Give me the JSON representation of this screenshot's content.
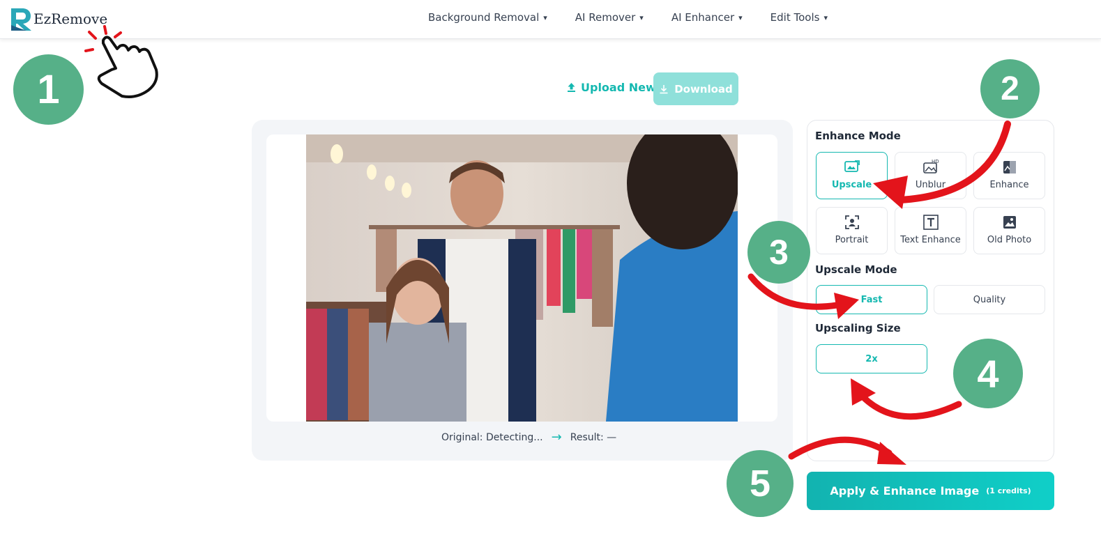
{
  "header": {
    "logo_text": "EzRemove",
    "nav": [
      {
        "label": "Background Removal",
        "caret": "▾"
      },
      {
        "label": "AI Remover",
        "caret": "▾"
      },
      {
        "label": "AI Enhancer",
        "caret": "▾"
      },
      {
        "label": "Edit Tools",
        "caret": "▾"
      }
    ]
  },
  "toolbar": {
    "upload_label": "Upload New",
    "upload_icon": "upload-icon",
    "download_label": "Download",
    "download_icon": "download-icon"
  },
  "preview": {
    "original_text": "Original: Detecting...",
    "arrow": "→",
    "result_text": "Result: —"
  },
  "panel": {
    "enhance_mode_label": "Enhance Mode",
    "modes": [
      {
        "label": "Upscale",
        "icon": "upscale-icon",
        "active": true
      },
      {
        "label": "Unblur",
        "icon": "hd-icon",
        "active": false
      },
      {
        "label": "Enhance",
        "icon": "enhance-icon",
        "active": false
      },
      {
        "label": "Portrait",
        "icon": "portrait-icon",
        "active": false
      },
      {
        "label": "Text Enhance",
        "icon": "text-icon",
        "active": false
      },
      {
        "label": "Old Photo",
        "icon": "photo-icon",
        "active": false
      }
    ],
    "upscale_mode_label": "Upscale Mode",
    "upscale_modes": [
      {
        "label": "Fast",
        "active": true
      },
      {
        "label": "Quality",
        "active": false
      }
    ],
    "upscaling_size_label": "Upscaling Size",
    "size_value": "2x"
  },
  "apply": {
    "label": "Apply & Enhance Image",
    "credits": "(1 credits)"
  },
  "tutorial_steps": [
    "1",
    "2",
    "3",
    "4",
    "5"
  ],
  "colors": {
    "accent": "#14b8b0",
    "step_circle": "#56b088",
    "annotation_arrow": "#e3141b"
  }
}
